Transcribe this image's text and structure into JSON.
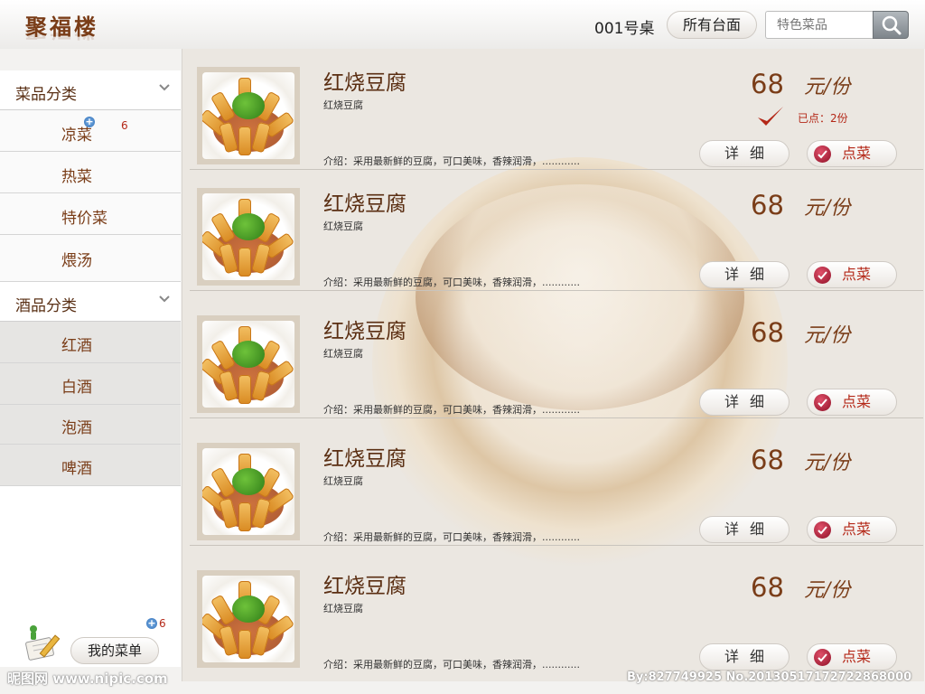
{
  "header": {
    "logo": "聚福楼",
    "table": "001号桌",
    "all_tables": "所有台面",
    "search_placeholder": "特色菜品"
  },
  "sidebar": {
    "dish_category": {
      "label": "菜品分类",
      "items": [
        {
          "label": "凉菜",
          "count": "6"
        },
        {
          "label": "热菜"
        },
        {
          "label": "特价菜"
        },
        {
          "label": "煨汤"
        }
      ]
    },
    "wine_category": {
      "label": "酒品分类",
      "items": [
        {
          "label": "红酒"
        },
        {
          "label": "白酒"
        },
        {
          "label": "泡酒"
        },
        {
          "label": "啤酒"
        }
      ]
    },
    "my_menu": {
      "label": "我的菜单",
      "count": "6"
    }
  },
  "dishes": [
    {
      "name": "红烧豆腐",
      "subtitle": "红烧豆腐",
      "desc": "介绍：采用最新鲜的豆腐，可口美味，香辣润滑，............",
      "price": "68",
      "unit": "元/份",
      "ordered": "已点：2份",
      "detail_label": "详细",
      "order_label": "点菜"
    },
    {
      "name": "红烧豆腐",
      "subtitle": "红烧豆腐",
      "desc": "介绍：采用最新鲜的豆腐，可口美味，香辣润滑，............",
      "price": "68",
      "unit": "元/份",
      "detail_label": "详细",
      "order_label": "点菜"
    },
    {
      "name": "红烧豆腐",
      "subtitle": "红烧豆腐",
      "desc": "介绍：采用最新鲜的豆腐，可口美味，香辣润滑，............",
      "price": "68",
      "unit": "元/份",
      "detail_label": "详细",
      "order_label": "点菜"
    },
    {
      "name": "红烧豆腐",
      "subtitle": "红烧豆腐",
      "desc": "介绍：采用最新鲜的豆腐，可口美味，香辣润滑，............",
      "price": "68",
      "unit": "元/份",
      "detail_label": "详细",
      "order_label": "点菜"
    },
    {
      "name": "红烧豆腐",
      "subtitle": "红烧豆腐",
      "desc": "介绍：采用最新鲜的豆腐，可口美味，香辣润滑，............",
      "price": "68",
      "unit": "元/份",
      "detail_label": "详细",
      "order_label": "点菜"
    }
  ],
  "watermark": {
    "left": "昵图网 www.nipic.com",
    "right": "By:827749925 No.20130517172722868000"
  },
  "colors": {
    "brand": "#7a3d18",
    "accent_red": "#b42818"
  },
  "icons": [
    "search-icon",
    "chevron-down-icon",
    "plus-badge-icon",
    "checkmark-icon",
    "order-dot-icon",
    "menu-pencil-icon"
  ]
}
